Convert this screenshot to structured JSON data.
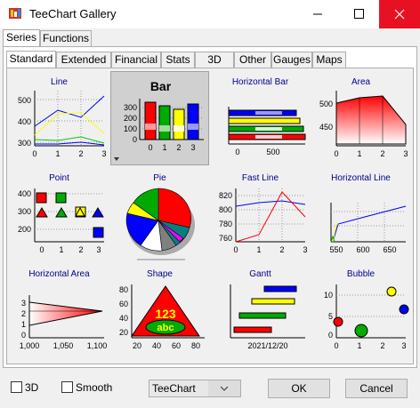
{
  "window": {
    "title": "TeeChart Gallery"
  },
  "outer_tabs": [
    {
      "label": "Series"
    },
    {
      "label": "Functions"
    }
  ],
  "inner_tabs": [
    {
      "label": "Standard"
    },
    {
      "label": "Extended"
    },
    {
      "label": "Financial"
    },
    {
      "label": "Stats"
    },
    {
      "label": "3D"
    },
    {
      "label": "Other"
    },
    {
      "label": "Gauges"
    },
    {
      "label": "Maps"
    }
  ],
  "gallery": [
    {
      "title": "Line"
    },
    {
      "title": "Bar"
    },
    {
      "title": "Horizontal Bar"
    },
    {
      "title": "Area"
    },
    {
      "title": "Point"
    },
    {
      "title": "Pie"
    },
    {
      "title": "Fast Line"
    },
    {
      "title": "Horizontal Line"
    },
    {
      "title": "Horizontal Area"
    },
    {
      "title": "Shape"
    },
    {
      "title": "Gantt"
    },
    {
      "title": "Bubble"
    }
  ],
  "ticks": {
    "line_y": [
      "500",
      "400",
      "300"
    ],
    "line_x": [
      "0",
      "1",
      "2",
      "3"
    ],
    "bar_y": [
      "300",
      "200",
      "100",
      "0"
    ],
    "bar_x": [
      "0",
      "1",
      "2",
      "3"
    ],
    "hbar_x": [
      "0",
      "500"
    ],
    "area_y": [
      "500",
      "450"
    ],
    "area_x": [
      "0",
      "1",
      "2",
      "3"
    ],
    "point_y": [
      "400",
      "300",
      "200"
    ],
    "point_x": [
      "0",
      "1",
      "2",
      "3"
    ],
    "fast_y": [
      "820",
      "800",
      "780",
      "760"
    ],
    "fast_x": [
      "0",
      "1",
      "2",
      "3"
    ],
    "hline_x": [
      "550",
      "600",
      "650"
    ],
    "harea_y": [
      "3",
      "2",
      "1",
      "0"
    ],
    "harea_x": [
      "1,000",
      "1,050",
      "1,100"
    ],
    "shape_y": [
      "80",
      "60",
      "40",
      "20"
    ],
    "shape_x": [
      "20",
      "40",
      "60",
      "80"
    ],
    "shape_text1": "123",
    "shape_text2": "abc",
    "gantt_x": "2021/12/20",
    "bubble_y": [
      "10",
      "5",
      "0"
    ],
    "bubble_x": [
      "0",
      "1",
      "2",
      "3"
    ]
  },
  "bottom": {
    "check_3d": "3D",
    "check_smooth": "Smooth",
    "combo_value": "TeeChart",
    "ok_label": "OK",
    "cancel_label": "Cancel"
  },
  "colors": {
    "close_hover": "#e81123",
    "title_blue": "#00008b",
    "selection": "#d0d0d0"
  }
}
